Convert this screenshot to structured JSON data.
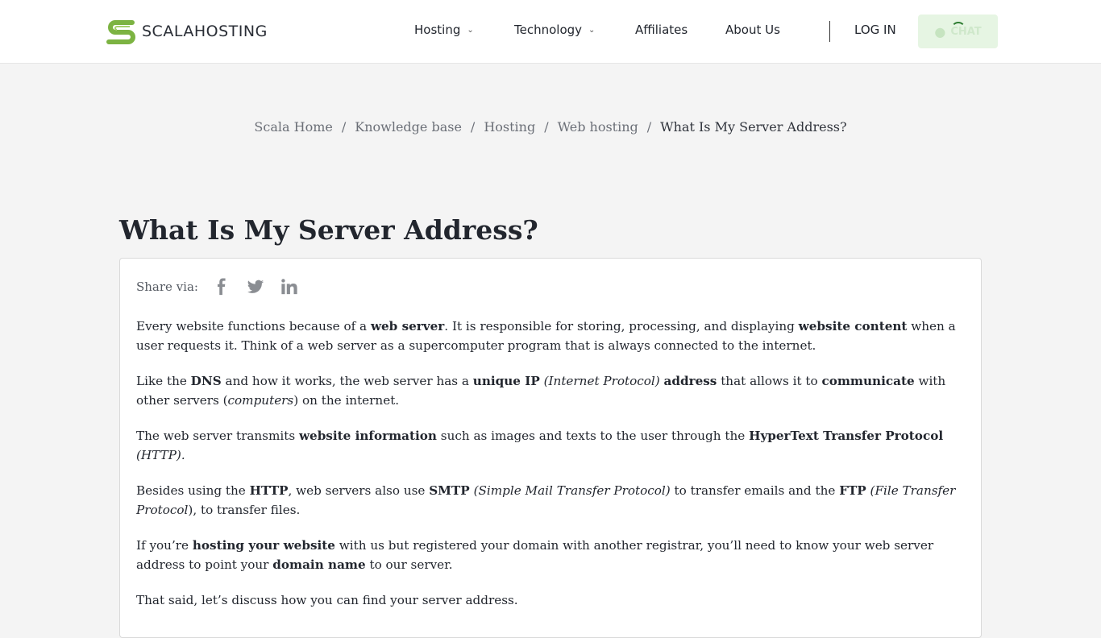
{
  "header": {
    "logo_text": "SCALAHOSTING",
    "nav": [
      {
        "label": "Hosting"
      },
      {
        "label": "Technology"
      },
      {
        "label": "Affiliates"
      },
      {
        "label": "About Us"
      }
    ],
    "login_label": "LOG IN",
    "chat_label": "CHAT"
  },
  "breadcrumb": [
    "Scala Home",
    "Knowledge base",
    "Hosting",
    "Web hosting",
    "What Is My Server Address?"
  ],
  "article": {
    "title": "What Is My Server Address?",
    "share_label": "Share via:",
    "p1": [
      "Every website functions because of a ",
      "web server",
      ". It is responsible for storing, processing, and displaying ",
      "website content",
      " when a user requests it. Think of a web server as a supercomputer program that is always connected to the internet."
    ],
    "p2": [
      "Like the ",
      "DNS",
      " and how it works, the web server has a ",
      "unique IP",
      " ",
      "(Internet Protocol)",
      " ",
      "address",
      " that allows it to ",
      "communicate",
      " with other servers (",
      "computers",
      ") on the internet."
    ],
    "p3": [
      "The web server transmits ",
      "website information",
      " such as images and texts to the user through the ",
      "HyperText Transfer Protocol",
      " ",
      "(HTTP)."
    ],
    "p4": [
      "Besides using the ",
      "HTTP",
      ", web servers also use ",
      "SMTP",
      " ",
      "(Simple Mail Transfer Protocol)",
      " to transfer emails and the ",
      "FTP",
      " ",
      "(File Transfer Protocol",
      "), to transfer files."
    ],
    "p5": [
      "If you’re ",
      "hosting your website",
      " with us but registered your domain with another registrar, you’ll need to know your web server address to point your ",
      "domain name",
      " to our server."
    ],
    "p6": "That said, let’s discuss how you can find your server address."
  },
  "colors": {
    "brand_green": "#7cb342",
    "text": "#22262e"
  },
  "icons": [
    "scala-logo-icon",
    "chevron-down-icon",
    "chat-user-icon",
    "facebook-icon",
    "twitter-icon",
    "linkedin-icon"
  ]
}
